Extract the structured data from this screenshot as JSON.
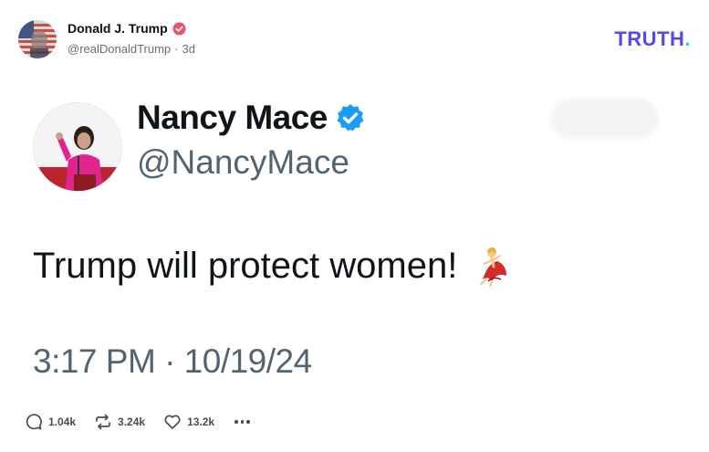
{
  "post": {
    "author_name": "Donald J. Trump",
    "author_handle": "@realDonaldTrump",
    "separator": "·",
    "age": "3d",
    "verified_color": "#e5566b",
    "avatar_icon": "american-flag-portrait"
  },
  "brand": {
    "logo_main": "TRUTH",
    "logo_dot": ".",
    "logo_color": "#5448ee",
    "dot_color": "#2ad4a3"
  },
  "tweet": {
    "name": "Nancy Mace",
    "handle": "@NancyMace",
    "text": "Trump will protect women!",
    "emoji_icon": "dancer-emoji",
    "timestamp": "3:17 PM · 10/19/24",
    "verified_color": "#1d9bf0",
    "avatar_icon": "speaker-at-podium-portrait"
  },
  "actions": {
    "replies": "1.04k",
    "retruths": "3.24k",
    "likes": "13.2k",
    "more_icon": "ellipsis-icon"
  }
}
